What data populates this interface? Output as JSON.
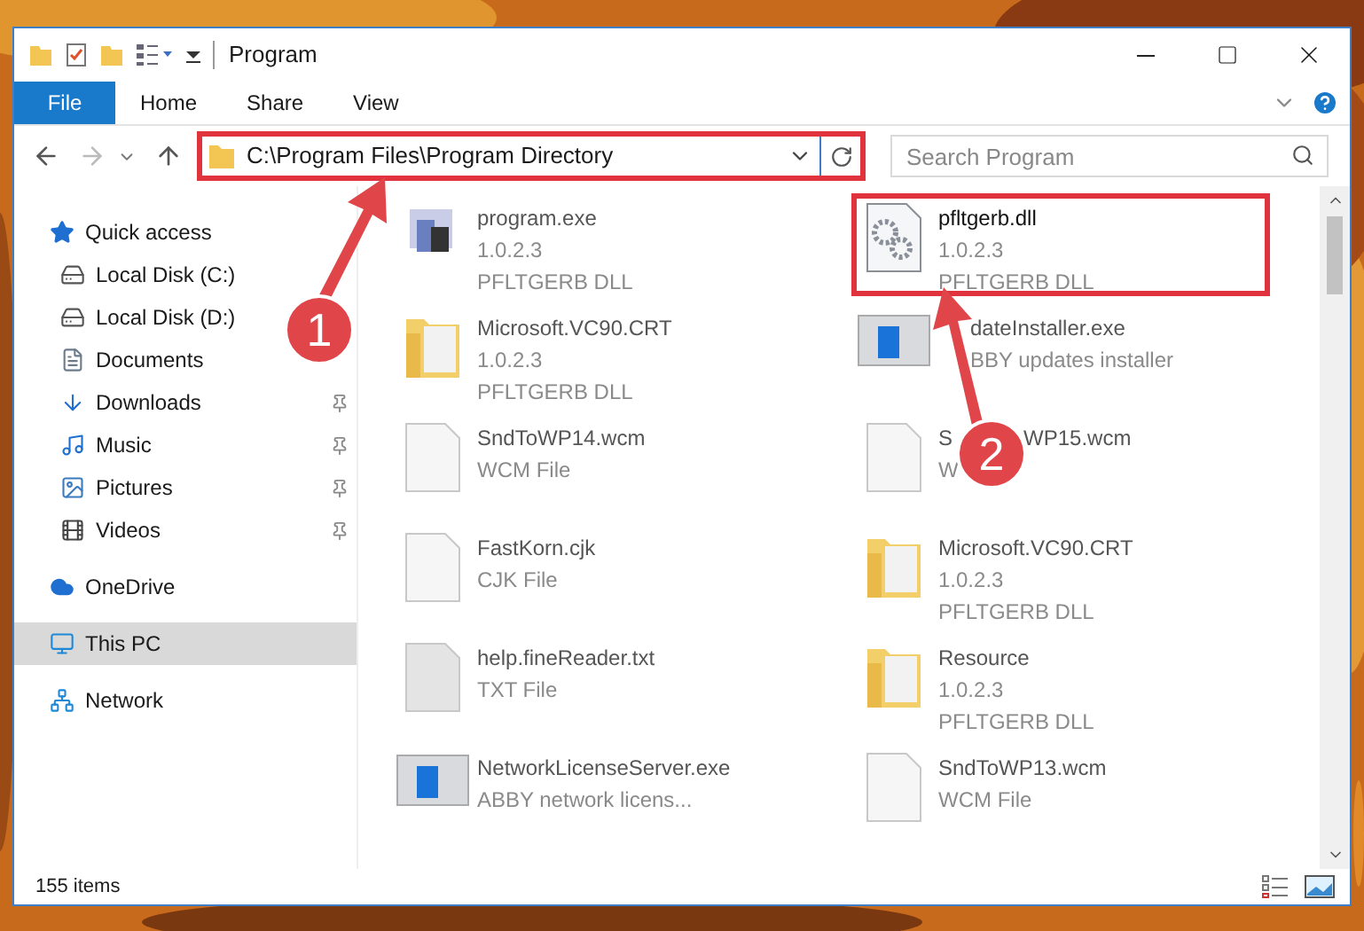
{
  "window": {
    "title": "Program"
  },
  "file_tab": "File",
  "ribbon_tabs": [
    {
      "label": "Home",
      "selected": false
    },
    {
      "label": "Share",
      "selected": false
    },
    {
      "label": "View",
      "selected": false
    }
  ],
  "address": {
    "path": "C:\\Program Files\\Program Directory",
    "highlighted": true
  },
  "search": {
    "placeholder": "Search Program"
  },
  "nav": [
    {
      "label": "Quick access",
      "kind": "star",
      "selected": false,
      "children": [
        {
          "label": "Local Disk (C:)",
          "kind": "drive",
          "pinned": false,
          "selected": false
        },
        {
          "label": "Local Disk (D:)",
          "kind": "drive",
          "pinned": false,
          "selected": false
        },
        {
          "label": "Documents",
          "kind": "documents",
          "pinned": false,
          "selected": false
        },
        {
          "label": "Downloads",
          "kind": "downloads",
          "pinned": true,
          "selected": false
        },
        {
          "label": "Music",
          "kind": "music",
          "pinned": true,
          "selected": false
        },
        {
          "label": "Pictures",
          "kind": "pictures",
          "pinned": true,
          "selected": false
        },
        {
          "label": "Videos",
          "kind": "videos",
          "pinned": true,
          "selected": false
        }
      ]
    },
    {
      "label": "OneDrive",
      "kind": "cloud",
      "selected": false
    },
    {
      "label": "This PC",
      "kind": "pc",
      "selected": true
    },
    {
      "label": "Network",
      "kind": "network",
      "selected": false
    }
  ],
  "files": [
    {
      "kind": "app",
      "name": [
        "program.exe"
      ],
      "lines": [
        "1.0.2.3",
        "PFLTGERB DLL"
      ],
      "highlighted": false
    },
    {
      "kind": "dll",
      "name": [
        "pfltgerb.dll"
      ],
      "lines": [
        "1.0.2.3",
        "PFLTGERB DLL"
      ],
      "highlighted": true
    },
    {
      "kind": "folder-doc",
      "name": [
        "Microsoft.VC90.CRT"
      ],
      "lines": [
        "1.0.2.3",
        "PFLTGERB DLL"
      ],
      "highlighted": false
    },
    {
      "kind": "installer",
      "name": [
        "dateInstaller.exe"
      ],
      "lines": [
        "BBY updates installer"
      ],
      "highlighted": false,
      "offset": true
    },
    {
      "kind": "file",
      "name": [
        "SndToWP14.wcm"
      ],
      "lines": [
        "WCM File"
      ],
      "highlighted": false
    },
    {
      "kind": "file",
      "name": [
        "S",
        "WP15.wcm"
      ],
      "lines": [
        "W"
      ],
      "highlighted": false
    },
    {
      "kind": "file",
      "name": [
        "FastKorn.cjk"
      ],
      "lines": [
        "CJK File"
      ],
      "highlighted": false
    },
    {
      "kind": "folder-doc",
      "name": [
        "Microsoft.VC90.CRT"
      ],
      "lines": [
        "1.0.2.3",
        "PFLTGERB DLL"
      ],
      "highlighted": false
    },
    {
      "kind": "file-grey",
      "name": [
        "help.fineReader.txt"
      ],
      "lines": [
        "TXT File"
      ],
      "highlighted": false
    },
    {
      "kind": "folder-doc",
      "name": [
        "Resource"
      ],
      "lines": [
        "1.0.2.3",
        "PFLTGERB DLL"
      ],
      "highlighted": false
    },
    {
      "kind": "installer",
      "name": [
        "NetworkLicenseServer.exe"
      ],
      "lines": [
        "ABBY network licens..."
      ],
      "highlighted": false
    },
    {
      "kind": "file",
      "name": [
        "SndToWP13.wcm"
      ],
      "lines": [
        "WCM File"
      ],
      "highlighted": false
    }
  ],
  "status_bar": "155 items",
  "annotations": [
    {
      "label": "1"
    },
    {
      "label": "2"
    }
  ]
}
